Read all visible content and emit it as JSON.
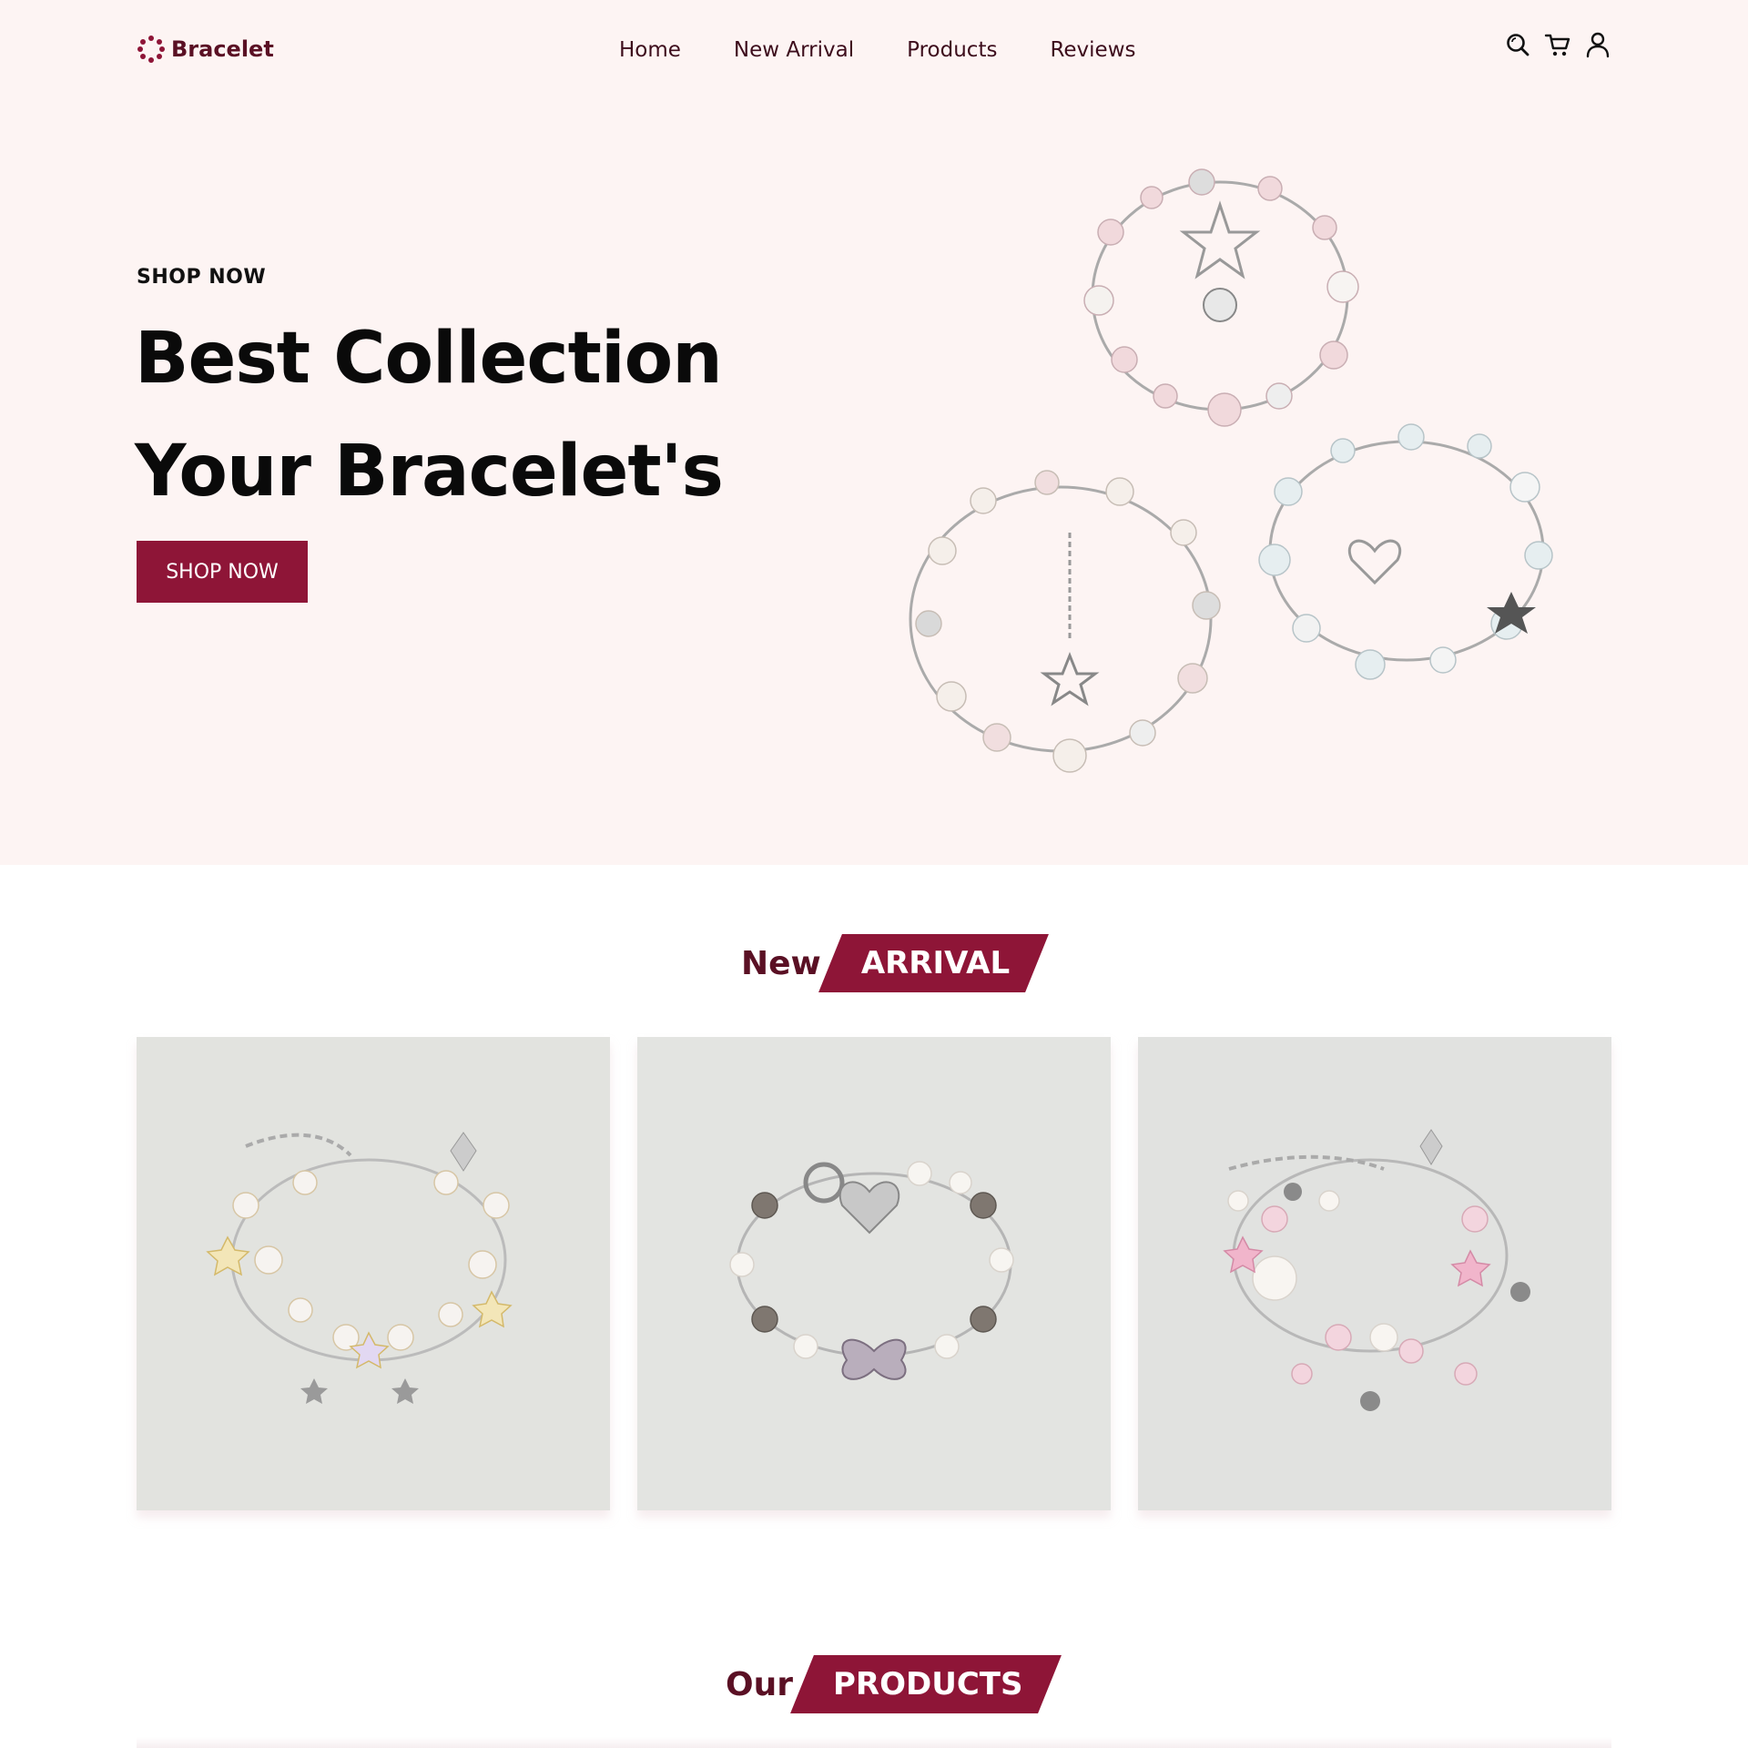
{
  "brand": {
    "name": "Bracelet",
    "accent_color": "#8e1537",
    "dark_color": "#5a1024",
    "hero_background": "#fdf4f3"
  },
  "nav": {
    "links": [
      "Home",
      "New Arrival",
      "Products",
      "Reviews"
    ],
    "icons": [
      "search-icon",
      "cart-icon",
      "user-icon"
    ]
  },
  "hero": {
    "kicker": "SHOP NOW",
    "title_line1": "Best Collection",
    "title_line2": "Your Bracelet's",
    "button_label": "SHOP NOW",
    "image": "three-charm-bracelets-photo"
  },
  "new_arrival": {
    "heading_plain": "New",
    "heading_tag": "ARRIVAL",
    "cards": [
      {
        "image": "star-crystal-bracelet-photo"
      },
      {
        "image": "pearl-butterfly-bracelet-photo"
      },
      {
        "image": "pink-flower-bracelet-photo"
      }
    ]
  },
  "products": {
    "heading_plain": "Our",
    "heading_tag": "PRODUCTS"
  }
}
